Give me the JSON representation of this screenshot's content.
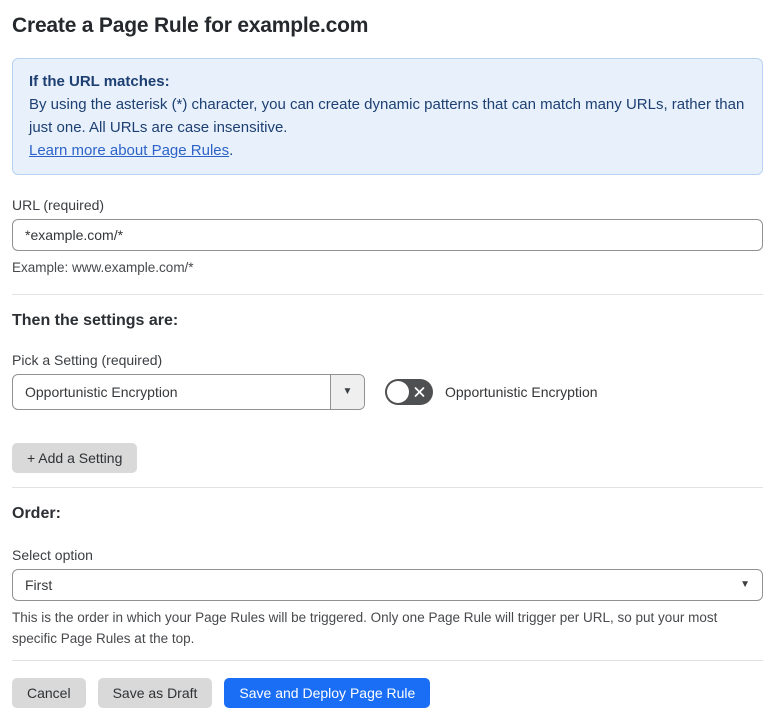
{
  "page": {
    "title": "Create a Page Rule for example.com"
  },
  "info_box": {
    "heading": "If the URL matches:",
    "body": "By using the asterisk (*) character, you can create dynamic patterns that can match many URLs, rather than just one. All URLs are case insensitive.",
    "link_label": "Learn more about Page Rules",
    "link_suffix": "."
  },
  "url_section": {
    "label": "URL (required)",
    "value": "*example.com/*",
    "helper": "Example: www.example.com/*"
  },
  "settings_section": {
    "heading": "Then the settings are:",
    "picker_label": "Pick a Setting (required)",
    "selected_setting": "Opportunistic Encryption",
    "toggle": {
      "state": "off",
      "label": "Opportunistic Encryption"
    },
    "add_setting_label": "+ Add a Setting"
  },
  "order_section": {
    "heading": "Order:",
    "select_label": "Select option",
    "selected_option": "First",
    "helper": "This is the order in which your Page Rules will be triggered. Only one Page Rule will trigger per URL, so put your most specific Page Rules at the top."
  },
  "footer": {
    "cancel_label": "Cancel",
    "save_draft_label": "Save as Draft",
    "save_deploy_label": "Save and Deploy Page Rule"
  },
  "colors": {
    "info_bg": "#e8f1fb",
    "info_border": "#b7d3f0",
    "info_text": "#1d3f72",
    "link": "#2d63c9",
    "primary_button": "#1a6ef5",
    "toggle_off": "#4f5052",
    "secondary_button": "#d9d9d9"
  }
}
